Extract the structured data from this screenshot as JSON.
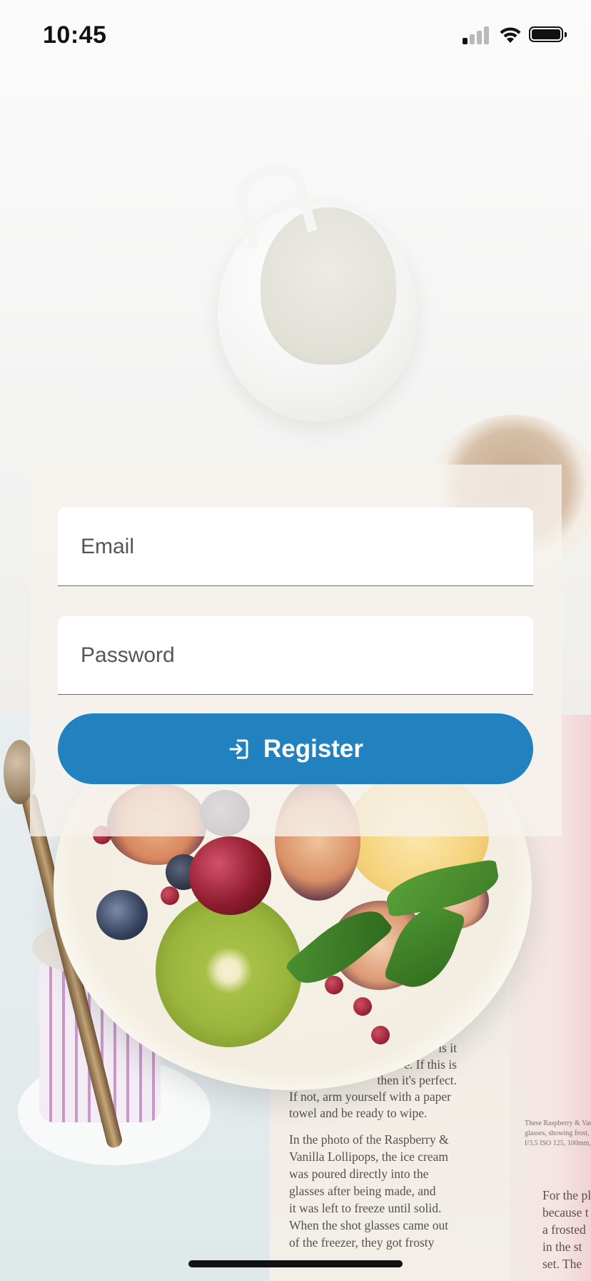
{
  "status_bar": {
    "time": "10:45",
    "icons": [
      "signal-icon",
      "wifi-icon",
      "battery-icon"
    ]
  },
  "form": {
    "email_placeholder": "Email",
    "password_placeholder": "Password",
    "register_label": "Register",
    "register_icon": "login-icon"
  },
  "background": {
    "magazine_text_upper": [
      "is it",
      "e. If this is",
      "then it's perfect.",
      "If not, arm yourself with a paper",
      "towel and be ready to wipe."
    ],
    "magazine_text": [
      "In the photo of the Raspberry &",
      "Vanilla Lollipops, the ice cream",
      "was poured directly into the",
      "glasses after being made, and",
      "it was left to freeze until solid.",
      "When the shot glasses came out",
      "of the freezer, they got frosty"
    ],
    "magazine_text_right": [
      "For the pl",
      "because t",
      "a frosted",
      "in the st",
      "set. The"
    ],
    "magazine_caption": [
      "These Raspberry & Vani",
      "glasses, showing frost, t",
      "f/3.5 ISO 125, 100mm,"
    ]
  },
  "colors": {
    "primary": "#2282c0",
    "panel": "#f6f3ed",
    "field": "#ffffff"
  }
}
